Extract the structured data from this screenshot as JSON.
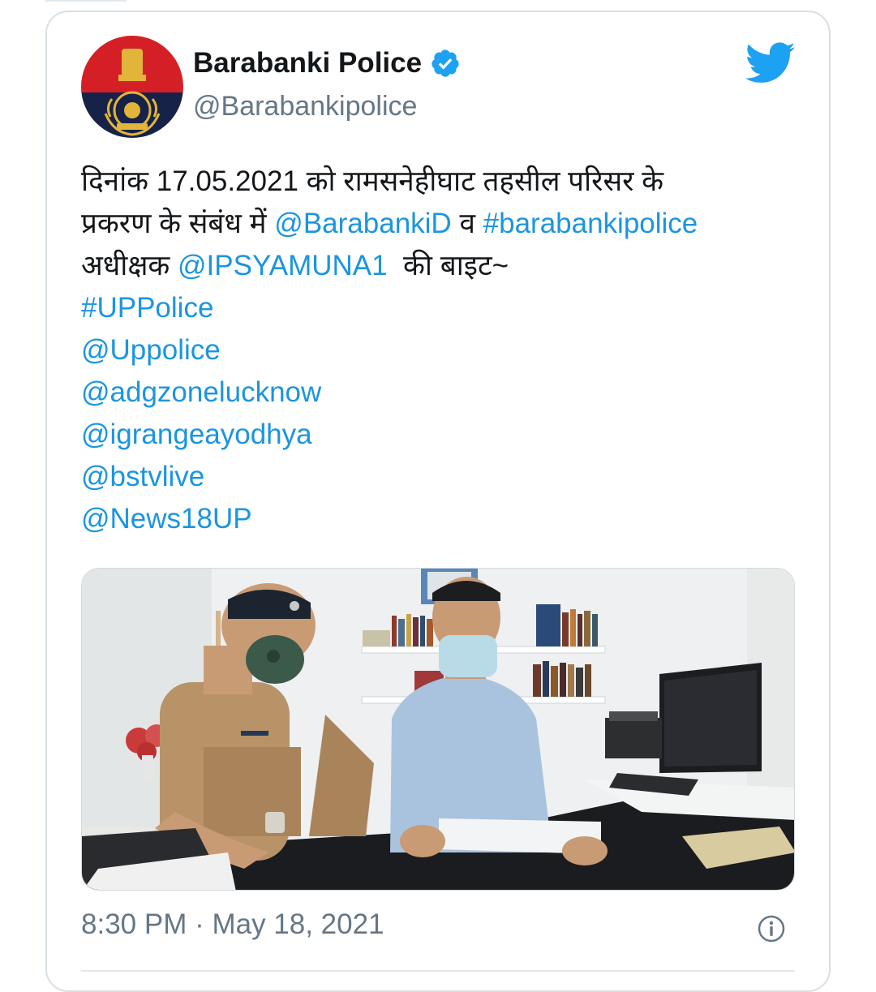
{
  "account": {
    "name": "Barabanki Police",
    "handle": "@Barabankipolice",
    "verified": true
  },
  "tweet": {
    "line1": "दिनांक 17.05.2021 को रामसनेहीघाट तहसील परिसर के",
    "line2_prefix": "प्रकरण के संबंध में ",
    "line2_mention": "@BarabankiD",
    "line2_mid": " व ",
    "line2_hashtag": "#barabankipolice",
    "line3_prefix": "अधीक्षक ",
    "line3_mention": "@IPSYAMUNA1",
    "line3_suffix": "  की बाइट~",
    "tags": [
      "#UPPolice",
      "@Uppolice",
      "@adgzonelucknow",
      "@igrangeayodhya",
      "@bstvlive",
      "@News18UP"
    ]
  },
  "timestamp": "8:30 PM · May 18, 2021",
  "colors": {
    "link": "#1b95e0",
    "text": "#14171a",
    "muted": "#657786",
    "twitter_blue": "#1da1f2",
    "avatar_red": "#d51f26",
    "avatar_navy": "#162248"
  },
  "icons": {
    "verified": "verified-badge-icon",
    "logo": "twitter-bird-icon",
    "info": "info-icon"
  }
}
